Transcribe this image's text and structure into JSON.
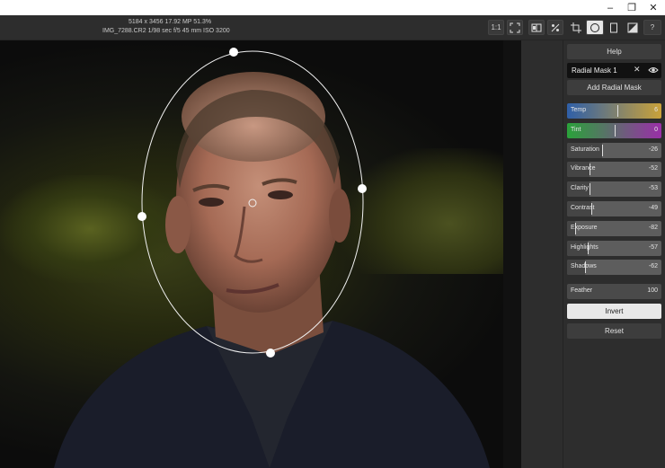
{
  "window": {
    "minimize_glyph": "–",
    "maximize_glyph": "❐",
    "close_glyph": "✕"
  },
  "image_info": {
    "line1": "5184 x 3456    17.92 MP    51.3%",
    "line2": "IMG_7288.CR2    1/98 sec    f/5    45 mm    ISO 3200"
  },
  "toolbar": {
    "zoom_label": "1:1",
    "tools": [
      {
        "icon": "fit-screen-icon"
      },
      {
        "icon": "compare-icon"
      },
      {
        "icon": "split-percent-icon"
      },
      {
        "icon": "crop-icon"
      },
      {
        "icon": "radial-mask-icon",
        "active": true
      },
      {
        "icon": "rectangle-icon"
      },
      {
        "icon": "gradient-mask-icon"
      },
      {
        "icon": "help-icon"
      }
    ],
    "help_glyph": "?"
  },
  "panel": {
    "help_label": "Help",
    "mask_name": "Radial Mask 1",
    "mask_close": "✕",
    "add_mask_label": "Add Radial Mask",
    "sliders": [
      {
        "label": "Temp",
        "value": "6",
        "level": 0.53
      },
      {
        "label": "Tint",
        "value": "0",
        "level": 0.5
      },
      {
        "label": "Saturation",
        "value": "-26",
        "level": 0.37
      },
      {
        "label": "Vibrance",
        "value": "-52",
        "level": 0.24
      },
      {
        "label": "Clarity",
        "value": "-53",
        "level": 0.235
      },
      {
        "label": "Contrast",
        "value": "-49",
        "level": 0.255
      },
      {
        "label": "Exposure",
        "value": "-82",
        "level": 0.09
      },
      {
        "label": "Highlights",
        "value": "-57",
        "level": 0.215
      },
      {
        "label": "Shadows",
        "value": "-62",
        "level": 0.19
      }
    ],
    "feather_label": "Feather",
    "feather_value": "100",
    "invert_label": "Invert",
    "reset_label": "Reset"
  },
  "colors": {
    "accent_active": "#e6e6e6",
    "panel_bg": "#2d2d2d",
    "temp_gradient": [
      "#2f5fa8",
      "#caa23a"
    ],
    "tint_gradient": [
      "#2aa23a",
      "#9a2fa8"
    ]
  }
}
